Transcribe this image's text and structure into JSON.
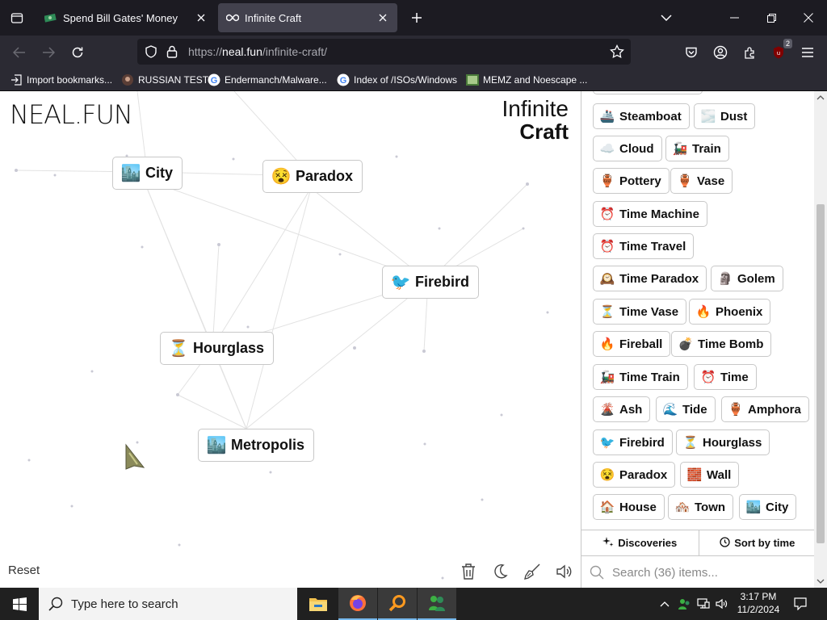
{
  "browser": {
    "tabs": [
      {
        "title": "Spend Bill Gates' Money",
        "active": false
      },
      {
        "title": "Infinite Craft",
        "active": true
      }
    ],
    "url_prefix": "https://",
    "url_host": "neal.fun",
    "url_path": "/infinite-craft/",
    "extension_badge": "2",
    "bookmarks": [
      {
        "label": "Import bookmarks...",
        "icon": "import-icon"
      },
      {
        "label": "RUSSIAN TEST",
        "icon": "site-favicon"
      },
      {
        "label": "Endermanch/Malware...",
        "icon": "google-icon"
      },
      {
        "label": "Index of /ISOs/Windows",
        "icon": "google-icon"
      },
      {
        "label": "MEMZ and Noescape ...",
        "icon": "image-icon"
      }
    ]
  },
  "page": {
    "logo_left": "NEAL.FUN",
    "logo_right_line1": "Infinite",
    "logo_right_line2": "Craft",
    "canvas_elements": [
      {
        "label": "City",
        "emoji": "🏙️"
      },
      {
        "label": "Paradox",
        "emoji": "😵"
      },
      {
        "label": "Firebird",
        "emoji": "🐦"
      },
      {
        "label": "Hourglass",
        "emoji": "⏳"
      },
      {
        "label": "Metropolis",
        "emoji": "🏙️"
      }
    ],
    "reset_label": "Reset",
    "tools": [
      "trash-icon",
      "moon-icon",
      "broom-icon",
      "sound-icon"
    ]
  },
  "sidebar": {
    "items": [
      {
        "label": "Steamboat",
        "emoji": "🚢"
      },
      {
        "label": "Dust",
        "emoji": "🌫️"
      },
      {
        "label": "Cloud",
        "emoji": "☁️"
      },
      {
        "label": "Train",
        "emoji": "🚂"
      },
      {
        "label": "Pottery",
        "emoji": "🏺"
      },
      {
        "label": "Vase",
        "emoji": "🏺"
      },
      {
        "label": "Time Machine",
        "emoji": "⏰"
      },
      {
        "label": "Time Travel",
        "emoji": "⏰"
      },
      {
        "label": "Time Paradox",
        "emoji": "🕰️"
      },
      {
        "label": "Golem",
        "emoji": "🗿"
      },
      {
        "label": "Time Vase",
        "emoji": "⏳"
      },
      {
        "label": "Phoenix",
        "emoji": "🔥"
      },
      {
        "label": "Fireball",
        "emoji": "🔥"
      },
      {
        "label": "Time Bomb",
        "emoji": "💣"
      },
      {
        "label": "Time Train",
        "emoji": "🚂"
      },
      {
        "label": "Time",
        "emoji": "⏰"
      },
      {
        "label": "Ash",
        "emoji": "🌋"
      },
      {
        "label": "Tide",
        "emoji": "🌊"
      },
      {
        "label": "Amphora",
        "emoji": "🏺"
      },
      {
        "label": "Firebird",
        "emoji": "🐦"
      },
      {
        "label": "Hourglass",
        "emoji": "⏳"
      },
      {
        "label": "Paradox",
        "emoji": "😵"
      },
      {
        "label": "Wall",
        "emoji": "🧱"
      },
      {
        "label": "House",
        "emoji": "🏠"
      },
      {
        "label": "Town",
        "emoji": "🏘️"
      },
      {
        "label": "City",
        "emoji": "🏙️"
      }
    ],
    "tab_discoveries": "Discoveries",
    "tab_sort": "Sort by time",
    "search_placeholder": "Search (36) items..."
  },
  "taskbar": {
    "search_placeholder": "Type here to search",
    "apps": [
      "file-explorer-icon",
      "firefox-icon",
      "search-tool-icon",
      "green-app-icon"
    ],
    "time": "3:17 PM",
    "date": "11/2/2024"
  }
}
